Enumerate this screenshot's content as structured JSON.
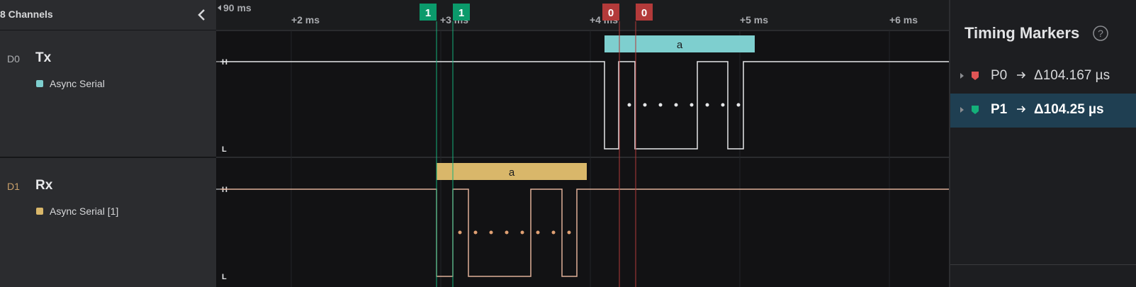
{
  "left_panel": {
    "header_title": "8 Channels",
    "channels": [
      {
        "id": "D0",
        "name": "Tx",
        "analyzer": "Async Serial",
        "color": "#7ecfcf"
      },
      {
        "id": "D1",
        "name": "Rx",
        "analyzer": "Async Serial [1]",
        "color": "#d9b76a"
      }
    ]
  },
  "timeline": {
    "offset_label": "90 ms",
    "ticks": [
      "+2 ms",
      "+3 ms",
      "+4 ms",
      "+5 ms",
      "+6 ms"
    ],
    "markers": [
      {
        "label": "1",
        "color": "#0b9a6b"
      },
      {
        "label": "1",
        "color": "#0b9a6b"
      },
      {
        "label": "0",
        "color": "#b33a3a"
      },
      {
        "label": "0",
        "color": "#b33a3a"
      }
    ],
    "level_high": "H",
    "level_low": "L",
    "decoded_tx": "a",
    "decoded_rx": "a"
  },
  "timing_markers": {
    "title": "Timing Markers",
    "items": [
      {
        "name": "P0",
        "value": "Δ104.167 µs",
        "color": "#e05555",
        "selected": false
      },
      {
        "name": "P1",
        "value": "Δ104.25 µs",
        "color": "#14b07a",
        "selected": true
      }
    ]
  }
}
